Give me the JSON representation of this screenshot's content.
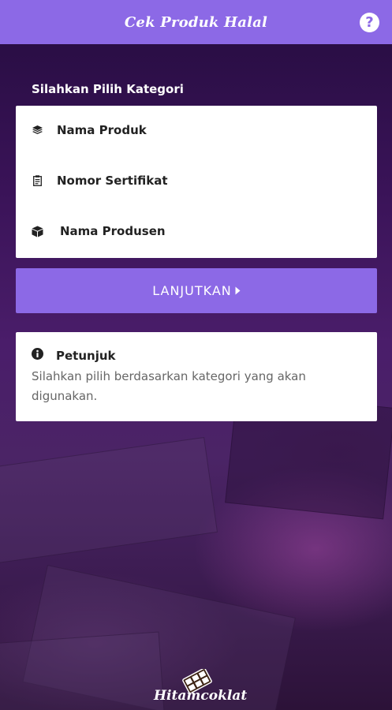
{
  "header": {
    "title": "Cek Produk Halal",
    "help_icon": "question-circle-icon",
    "help_symbol": "?"
  },
  "main": {
    "section_label": "Silahkan Pilih Kategori",
    "categories": [
      {
        "label": "Nama Produk",
        "icon": "layers-icon"
      },
      {
        "label": "Nomor Sertifikat",
        "icon": "clipboard-icon"
      },
      {
        "label": "Nama Produsen",
        "icon": "cube-icon"
      }
    ],
    "continue_label": "LANJUTKAN",
    "continue_icon": "caret-right-icon"
  },
  "info": {
    "title": "Petunjuk",
    "icon": "info-circle-icon",
    "text": "Silahkan pilih berdasarkan kategori yang akan digunakan."
  },
  "footer": {
    "brand": "Hitamcoklat",
    "logo_icon": "chocolate-bar-icon"
  },
  "colors": {
    "accent": "#8c69e6",
    "card": "#ffffff",
    "background": "#3a1358"
  }
}
